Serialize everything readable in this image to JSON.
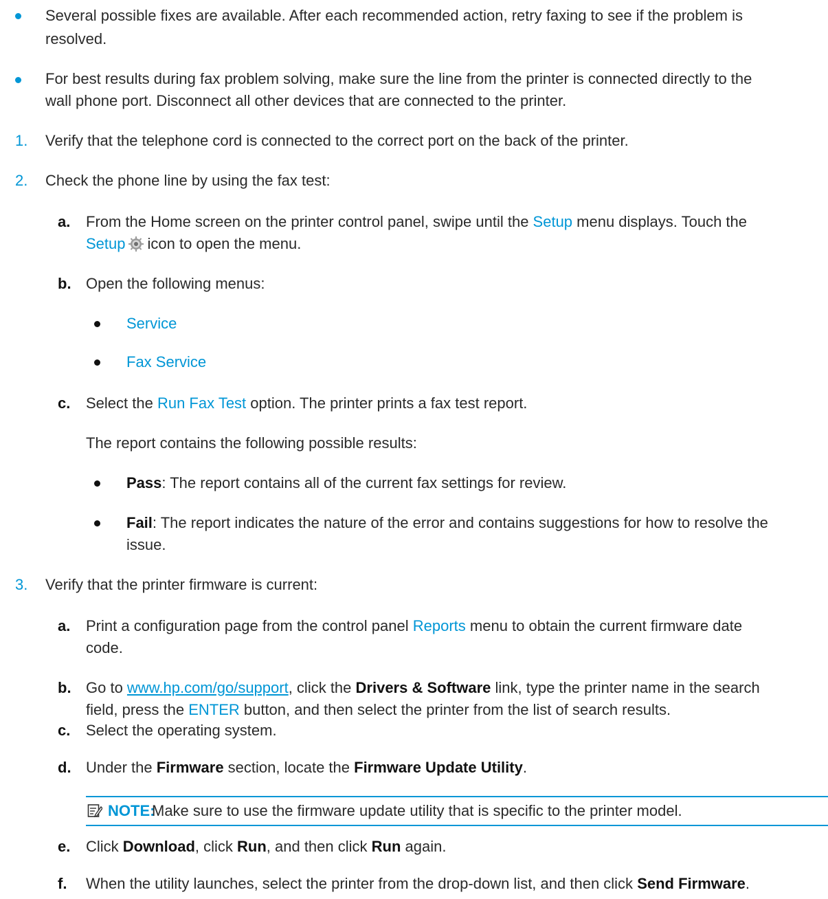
{
  "p1": {
    "line1": "Several possible fixes are available. After each recommended action, retry faxing to see if the problem is",
    "line2": "resolved."
  },
  "p2": {
    "line1": "For best results during fax problem solving, make sure the line from the printer is connected directly to the",
    "line2": "wall phone port. Disconnect all other devices that are connected to the printer."
  },
  "step1": {
    "num": "1.",
    "text": "Verify that the telephone cord is connected to the correct port on the back of the printer."
  },
  "step2": {
    "num": "2.",
    "text": "Check the phone line by using the fax test:",
    "a": {
      "letter": "a.",
      "l1_pre": "From the Home screen on the printer control panel, swipe until the ",
      "l1_link": "Setup",
      "l1_post": " menu displays. Touch the",
      "l2_link": "Setup",
      "l2_post": "icon to open the menu."
    },
    "b": {
      "letter": "b.",
      "text": "Open the following menus:",
      "items": [
        "Service",
        "Fax Service"
      ]
    },
    "c": {
      "letter": "c.",
      "pre": "Select the ",
      "link": "Run Fax Test",
      "post": " option. The printer prints a fax test report.",
      "results_intro": "The report contains the following possible results:",
      "pass_label": "Pass",
      "pass_text": ": The report contains all of the current fax settings for review.",
      "fail_label": "Fail",
      "fail_text1": ": The report indicates the nature of the error and contains suggestions for how to resolve the",
      "fail_text2": "issue."
    }
  },
  "step3": {
    "num": "3.",
    "text": "Verify that the printer firmware is current:",
    "a": {
      "letter": "a.",
      "l1_pre": "Print a configuration page from the control panel ",
      "l1_link": "Reports",
      "l1_post": " menu to obtain the current firmware date",
      "l2": "code."
    },
    "b": {
      "letter": "b.",
      "pre": "Go to ",
      "url": "www.hp.com/go/support",
      "mid1": ", click the ",
      "bold1": "Drivers & Software",
      "mid2": " link, type the printer name in the search",
      "l2_pre": "field, press the ",
      "l2_link": "ENTER",
      "l2_post": " button, and then select the printer from the list of search results."
    },
    "c": {
      "letter": "c.",
      "text": "Select the operating system."
    },
    "d": {
      "letter": "d.",
      "pre": "Under the ",
      "bold1": "Firmware",
      "mid": " section, locate the ",
      "bold2": "Firmware Update Utility",
      "post": "."
    },
    "note": {
      "label": "NOTE:",
      "text": "Make sure to use the firmware update utility that is specific to the printer model."
    },
    "e": {
      "letter": "e.",
      "pre": "Click ",
      "bold1": "Download",
      "mid1": ", click ",
      "bold2": "Run",
      "mid2": ", and then click ",
      "bold3": "Run",
      "post": " again."
    },
    "f": {
      "letter": "f.",
      "pre": "When the utility launches, select the printer from the drop-down list, and then click ",
      "bold1": "Send Firmware",
      "post": "."
    }
  }
}
